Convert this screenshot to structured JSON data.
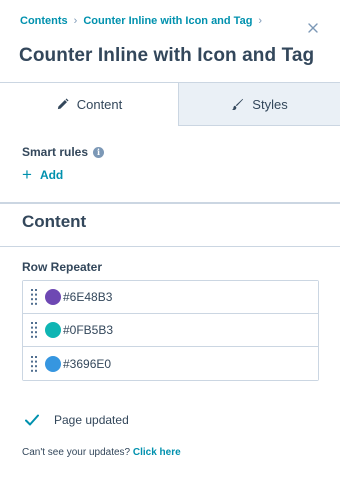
{
  "breadcrumb": {
    "items": [
      "Contents",
      "Counter Inline with Icon and Tag"
    ],
    "separator": "›"
  },
  "header": {
    "title": "Counter Inline with Icon and Tag",
    "close_icon": "close-icon"
  },
  "tabs": [
    {
      "label": "Content",
      "icon": "pencil-icon",
      "active": true
    },
    {
      "label": "Styles",
      "icon": "brush-icon",
      "active": false
    }
  ],
  "smart_rules": {
    "label": "Smart rules",
    "info_icon": "i",
    "add_label": "Add"
  },
  "content_section": {
    "title": "Content",
    "repeater_label": "Row Repeater",
    "rows": [
      {
        "text": "#6E48B3",
        "color": "#6E48B3"
      },
      {
        "text": "#0FB5B3",
        "color": "#0FB5B3"
      },
      {
        "text": "#3696E0",
        "color": "#3696E0"
      }
    ]
  },
  "status": {
    "text": "Page updated",
    "icon": "checkmark-icon"
  },
  "help": {
    "text": "Can't see your updates?",
    "link_label": "Click here"
  },
  "colors": {
    "accent": "#0091ae",
    "text": "#33475b",
    "border": "#cbd6e2",
    "tab_inactive_bg": "#eaf0f6"
  }
}
